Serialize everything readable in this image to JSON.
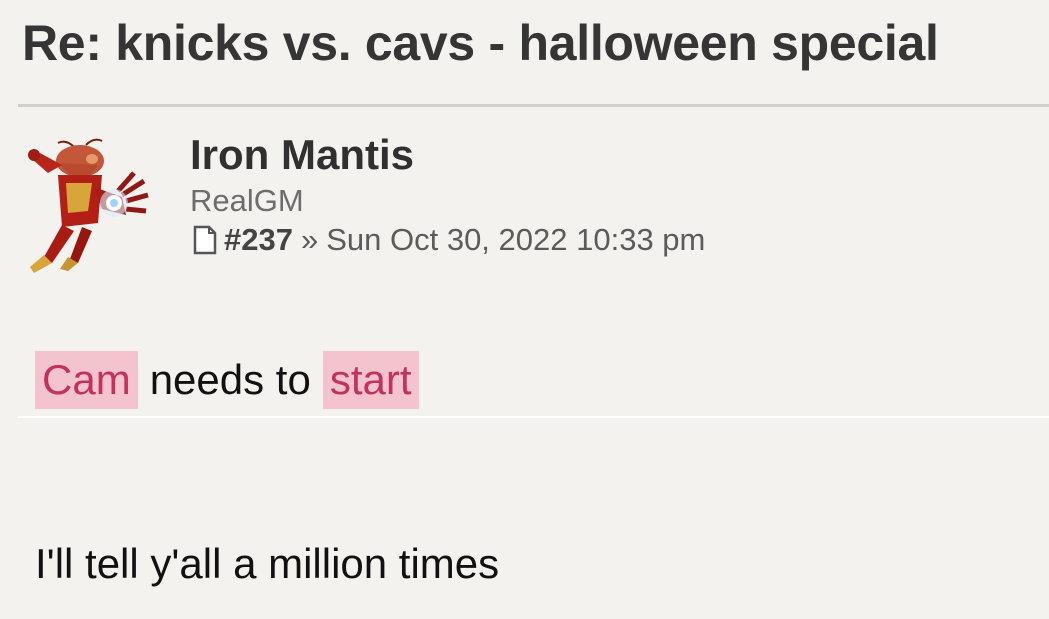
{
  "topic": {
    "title": "Re: knicks vs. cavs - halloween special"
  },
  "post": {
    "author": "Iron Mantis",
    "rank": "RealGM",
    "number": "#237",
    "separator": "»",
    "timestamp": "Sun Oct 30, 2022 10:33 pm",
    "avatar_icon": "iron-man-mantis-avatar-icon",
    "post_icon": "post-document-icon",
    "body": {
      "line1_word1": "Cam",
      "line1_middle": "needs to",
      "line1_word2": "start",
      "line2": "I'll tell y'all a million times"
    }
  },
  "colors": {
    "background": "#f4f2ee",
    "highlight_bg": "#f3c3ce",
    "highlight_text": "#c2325c",
    "title_text": "#353535"
  }
}
